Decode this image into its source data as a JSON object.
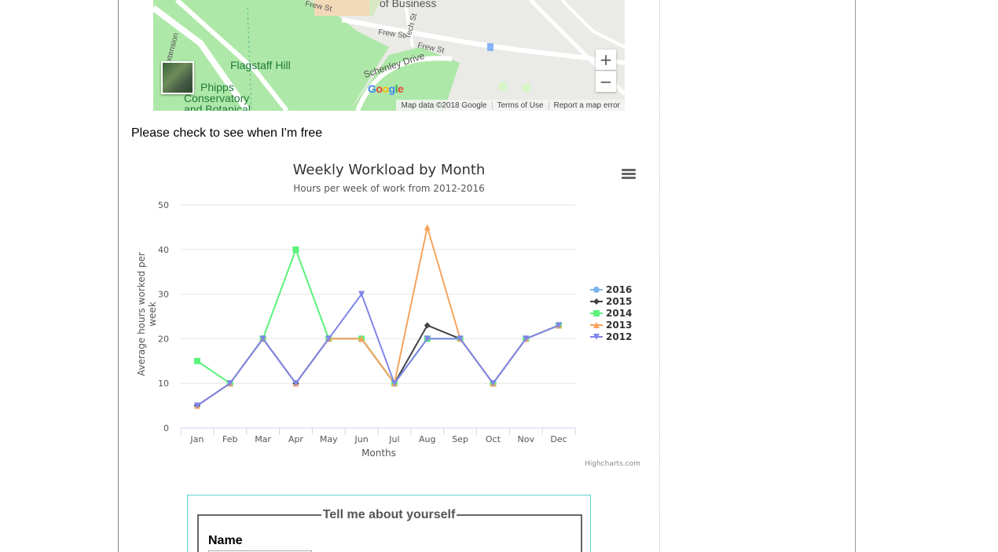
{
  "map": {
    "labels": {
      "flagstaff_hill": "Flagstaff Hill",
      "phipps_line1": "Phipps",
      "phipps_line2": "Conservatory",
      "phipps_line3": "and Botanical",
      "of_business": "of Business",
      "frew_st_1": "Frew St",
      "frew_st_2": "Frew St",
      "frew_st_3": "Frew St",
      "schenley_drive": "Schenley Drive",
      "tech_st": "Tech St",
      "extension": "Extension"
    },
    "zoom_in": "+",
    "zoom_out": "−",
    "google_logo": "Google",
    "attribution": {
      "map_data": "Map data ©2018 Google",
      "terms": "Terms of Use",
      "report": "Report a map error"
    }
  },
  "intro_text": "Please check to see when I'm free",
  "chart_data": {
    "type": "line",
    "title": "Weekly Workload by Month",
    "subtitle": "Hours per week of work from 2012-2016",
    "xlabel": "Months",
    "ylabel": "Average hours worked per week",
    "categories": [
      "Jan",
      "Feb",
      "Mar",
      "Apr",
      "May",
      "Jun",
      "Jul",
      "Aug",
      "Sep",
      "Oct",
      "Nov",
      "Dec"
    ],
    "ylim": [
      0,
      50
    ],
    "yticks": [
      0,
      10,
      20,
      30,
      40,
      50
    ],
    "grid": true,
    "legend_position": "right",
    "credits": "Highcharts.com",
    "series": [
      {
        "name": "2016",
        "color": "#7cb5ec",
        "marker": "circle",
        "values": [
          5,
          10,
          20,
          10,
          20,
          20,
          10,
          20,
          20,
          10,
          20,
          23
        ]
      },
      {
        "name": "2015",
        "color": "#434348",
        "marker": "diamond",
        "values": [
          5,
          10,
          20,
          10,
          20,
          20,
          10,
          23,
          20,
          10,
          20,
          23
        ]
      },
      {
        "name": "2014",
        "color": "#5af37a",
        "marker": "square",
        "values": [
          15,
          10,
          20,
          40,
          20,
          20,
          10,
          20,
          20,
          10,
          20,
          23
        ]
      },
      {
        "name": "2013",
        "color": "#f7a35c",
        "marker": "triangle",
        "values": [
          5,
          10,
          20,
          10,
          20,
          20,
          10,
          45,
          20,
          10,
          20,
          23
        ]
      },
      {
        "name": "2012",
        "color": "#8085e9",
        "marker": "triangle-down",
        "values": [
          5,
          10,
          20,
          10,
          20,
          30,
          10,
          20,
          20,
          10,
          20,
          23
        ]
      }
    ]
  },
  "form": {
    "legend": "Tell me about yourself",
    "name_label": "Name"
  }
}
